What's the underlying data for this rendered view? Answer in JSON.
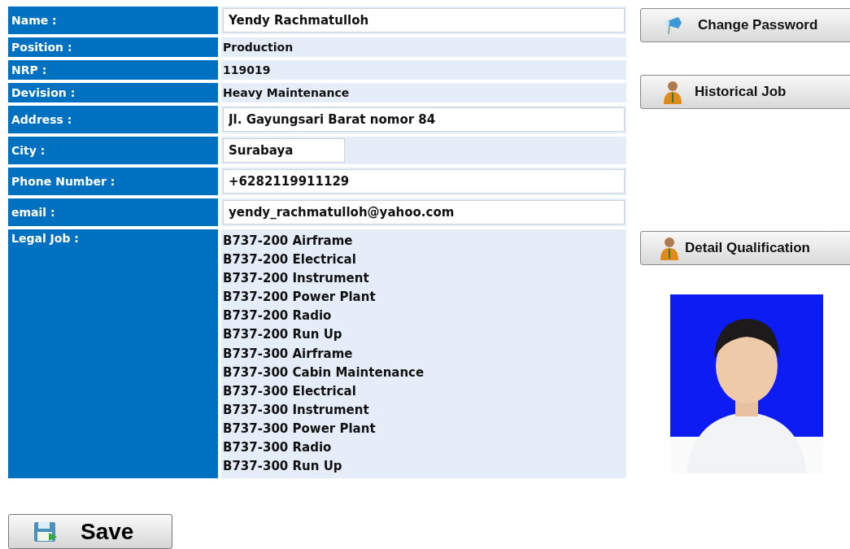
{
  "fields": [
    {
      "label": "Name :",
      "kind": "input",
      "value": "Yendy Rachmatulloh"
    },
    {
      "label": "Position :",
      "kind": "text",
      "value": "Production"
    },
    {
      "label": "NRP :",
      "kind": "text",
      "value": "119019"
    },
    {
      "label": "Devision :",
      "kind": "text",
      "value": "Heavy Maintenance"
    },
    {
      "label": "Address :",
      "kind": "input",
      "value": "Jl. Gayungsari Barat nomor 84"
    },
    {
      "label": "City :",
      "kind": "short-input",
      "value": "Surabaya"
    },
    {
      "label": "Phone Number :",
      "kind": "input",
      "value": "+6282119911129"
    },
    {
      "label": "email :",
      "kind": "input",
      "value": "yendy_rachmatulloh@yahoo.com"
    }
  ],
  "legal_job": {
    "label": "Legal Job :",
    "items": [
      "B737-200 Airframe",
      "B737-200 Electrical",
      "B737-200 Instrument",
      "B737-200 Power Plant",
      "B737-200 Radio",
      "B737-200 Run Up",
      "B737-300 Airframe",
      "B737-300 Cabin Maintenance",
      "B737-300 Electrical",
      "B737-300 Instrument",
      "B737-300 Power Plant",
      "B737-300 Radio",
      "B737-300 Run Up"
    ]
  },
  "side_buttons": [
    {
      "label": "Change Password",
      "kind": "megaphone"
    },
    {
      "label": "Historical Job",
      "kind": "person"
    },
    {
      "label": "Detail Qualification",
      "kind": "person"
    }
  ],
  "save_button": {
    "label": "Save"
  }
}
